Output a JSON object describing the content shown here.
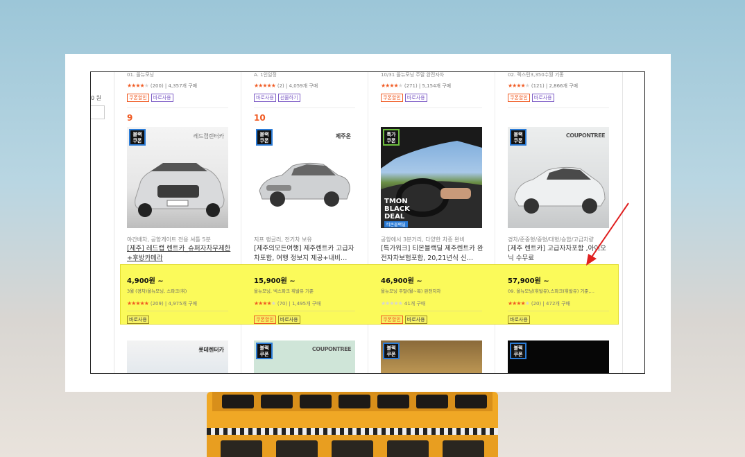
{
  "left_panel": {
    "price_suffix": "0 원"
  },
  "top_row": [
    {
      "info": "01. 올뉴모닝",
      "stars": "★★★★★",
      "rating": "(200) | 4,357개 구매",
      "tags": [
        {
          "label": "쿠폰할인",
          "kind": "coupon"
        },
        {
          "label": "바로사용",
          "kind": "direct"
        }
      ]
    },
    {
      "info": "A. 1인일정",
      "stars": "★★★★★",
      "rating": "(2) | 4,059개 구매",
      "tags": [
        {
          "label": "바로사용",
          "kind": "direct"
        },
        {
          "label": "선물하기",
          "kind": "gift"
        }
      ]
    },
    {
      "info": "10/31 올뉴모닝 주말 완전자차",
      "stars": "★★★★★",
      "rating": "(271) | 5,154개 구매",
      "tags": [
        {
          "label": "쿠폰할인",
          "kind": "coupon"
        },
        {
          "label": "바로사용",
          "kind": "direct"
        }
      ]
    },
    {
      "info": "02. 렉스턴3,350수월 기종",
      "stars": "★★★★★",
      "rating": "(121) | 2,866개 구매",
      "tags": [
        {
          "label": "쿠폰할인",
          "kind": "coupon"
        },
        {
          "label": "바로사용",
          "kind": "direct"
        }
      ]
    }
  ],
  "products": [
    {
      "rank": "9",
      "badge": "블랙\n쿠폰",
      "brand": "레드캡렌터카",
      "subtitle": "야간배차, 공항게이트 전용 셔틀 5분",
      "title": "[제주] 레드캡 렌트카_슈퍼자차무제한+후방카메라",
      "price": "4,900원 ~",
      "info": "3월 (경차)올뉴모닝, 스파크(휘)",
      "stars_on": 5,
      "rating": "(209) | 4,975개 구매",
      "tags": [
        {
          "label": "바로사용",
          "kind": "plain"
        }
      ]
    },
    {
      "rank": "10",
      "badge": "블랙\n쿠폰",
      "brand": "제주온",
      "subtitle": "지프 랭글러, 전기차 보유",
      "title": "[제주의모든여행] 제주렌트카 고급자차포함, 여행 정보지 제공+내비…",
      "price": "15,900원 ~",
      "info": "올뉴모닝, 넥스파크 휘발유 기준",
      "stars_on": 4,
      "rating": "(70) | 1,495개 구매",
      "tags": [
        {
          "label": "쿠폰할인",
          "kind": "coupon"
        },
        {
          "label": "바로사용",
          "kind": "plain"
        }
      ]
    },
    {
      "rank": "",
      "badge": "특가\n쿠폰",
      "brand": "",
      "deal_text": "TMON BLACK DEAL",
      "deal_sub": "티몬블랙딜",
      "subtitle": "공항에서 3분거리, 다양한 차종 완비",
      "title": "[특가워크] 티몬블랙딜 제주렌트카 완전자차보험포함, 20,21년식 신…",
      "price": "46,900원 ~",
      "info": "올뉴모닝 주말(월~목) 완전자차",
      "stars_on": 0,
      "rating": "41개 구매",
      "tags": [
        {
          "label": "쿠폰할인",
          "kind": "coupon"
        },
        {
          "label": "바로사용",
          "kind": "plain"
        }
      ]
    },
    {
      "rank": "",
      "badge": "블랙\n쿠폰",
      "brand": "COUPONTREE",
      "subtitle": "경차/준중형/중형/대형/승합/고급차량",
      "title": "[제주 렌트카] 고급자차포함 ,아이오닉 수무료",
      "price": "57,900원 ~",
      "info": "09. 올뉴모닝(휘발유),스파크(휘발유) 기준,…",
      "stars_on": 4,
      "rating": "(20) | 472개 구매",
      "tags": [
        {
          "label": "바로사용",
          "kind": "plain"
        }
      ]
    }
  ],
  "bottom_row": [
    {
      "brand": "롯데렌터카",
      "badge": ""
    },
    {
      "brand": "COUPONTREE",
      "badge": "블랙\n쿠폰"
    },
    {
      "brand": "",
      "badge": "블랙\n쿠폰"
    },
    {
      "brand": "",
      "badge": "블랙\n쿠폰"
    }
  ],
  "colors": {
    "accent": "#f05a22",
    "highlight": "#fbfa5a",
    "arrow": "#e02020"
  }
}
